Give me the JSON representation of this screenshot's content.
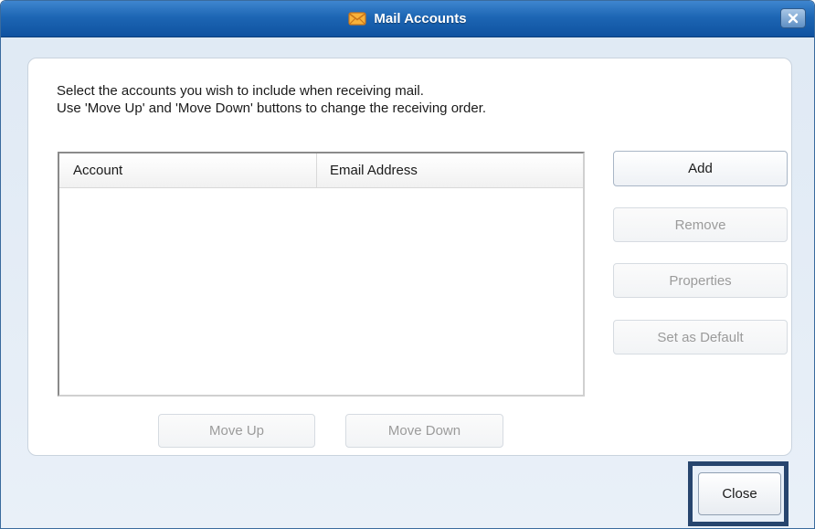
{
  "window": {
    "title": "Mail Accounts",
    "title_icon": "envelope-icon",
    "close_icon": "close-x-icon"
  },
  "instructions": {
    "line1": "Select the accounts you wish to include when receiving mail.",
    "line2": "Use 'Move Up' and 'Move Down' buttons to change the receiving order."
  },
  "accounts_list": {
    "columns": [
      "Account",
      "Email Address"
    ],
    "rows": []
  },
  "buttons": {
    "add": "Add",
    "remove": "Remove",
    "properties": "Properties",
    "set_default": "Set as Default",
    "move_up": "Move Up",
    "move_down": "Move Down",
    "close": "Close"
  },
  "colors": {
    "titlebar": "#1d66b4",
    "highlight_border": "#27456e",
    "disabled_text": "#9b9b9b"
  }
}
